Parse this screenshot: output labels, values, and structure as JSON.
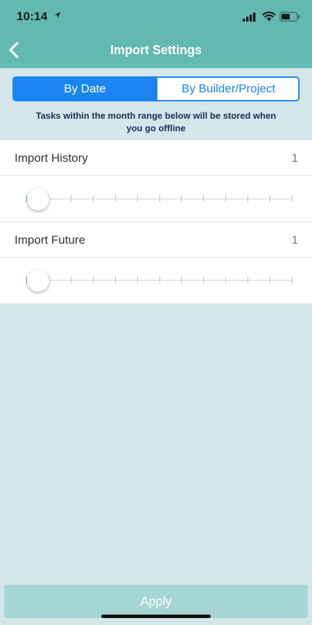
{
  "status_bar": {
    "time": "10:14",
    "location_icon": "location-arrow-icon",
    "signal_icon": "cellular-signal-icon",
    "wifi_icon": "wifi-icon",
    "battery_icon": "battery-icon"
  },
  "nav": {
    "back_icon": "chevron-left-icon",
    "title": "Import Settings"
  },
  "segments": {
    "selected": "By Date",
    "options": [
      "By Date",
      "By Builder/Project"
    ]
  },
  "info_text": "Tasks within the month range below will be stored when you go offline",
  "settings": [
    {
      "label": "Import History",
      "value": "1",
      "slider": {
        "min": 1,
        "max": 13,
        "value": 1
      }
    },
    {
      "label": "Import Future",
      "value": "1",
      "slider": {
        "min": 1,
        "max": 13,
        "value": 1
      }
    }
  ],
  "apply": {
    "label": "Apply"
  },
  "colors": {
    "header": "#61b9b0",
    "accent": "#1a84f0",
    "background": "#d3e6ea",
    "apply_disabled": "#a6d5d5"
  }
}
